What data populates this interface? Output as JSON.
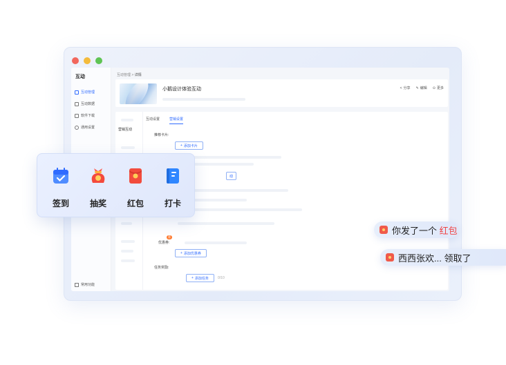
{
  "sidebar": {
    "title": "互动",
    "items": [
      {
        "label": "互动管理",
        "active": true
      },
      {
        "label": "互动数据",
        "active": false
      },
      {
        "label": "软件下载",
        "active": false
      },
      {
        "label": "通用设置",
        "active": false
      }
    ],
    "bottom_label": "常用功能"
  },
  "breadcrumb": {
    "parent": "互动管理",
    "separator": ">",
    "current": "详情"
  },
  "header": {
    "title": "小鹅设计体验互动",
    "actions": {
      "share": "分享",
      "edit": "编辑",
      "more": "更多"
    }
  },
  "tabs": [
    {
      "label": "互动设置",
      "active": false
    },
    {
      "label": "营销设置",
      "active": true
    }
  ],
  "left_nav": {
    "active_label": "营销互动"
  },
  "form": {
    "recommend_card_label": "推荐卡片:",
    "add_card_button": "添加卡片",
    "partial_button_text": "动",
    "coupon_label": "优惠券:",
    "coupon_badge": "荐",
    "add_coupon_button": "添加优惠券",
    "task_reward_label": "任务奖励:",
    "add_task_button": "添加任务",
    "task_count": "0/10"
  },
  "float_panel": {
    "items": [
      {
        "label": "签到",
        "icon": "calendar-check-icon"
      },
      {
        "label": "抽奖",
        "icon": "lucky-bag-icon"
      },
      {
        "label": "红包",
        "icon": "red-envelope-icon"
      },
      {
        "label": "打卡",
        "icon": "notebook-icon"
      }
    ]
  },
  "bubbles": {
    "first": {
      "prefix": "你发了一个",
      "highlight": "红包"
    },
    "second": {
      "text": "西西张欢... 领取了"
    }
  },
  "colors": {
    "accent": "#2f6bff",
    "highlight_red": "#f04444"
  }
}
